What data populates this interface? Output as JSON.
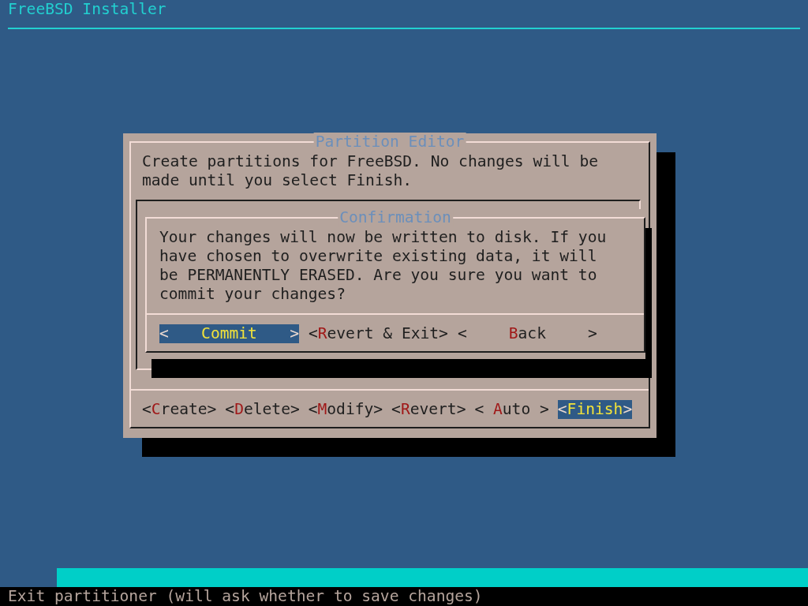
{
  "header": {
    "title": "FreeBSD Installer"
  },
  "dialog": {
    "title": "Partition Editor",
    "message": "Create partitions for FreeBSD. No changes will be made until you select Finish.",
    "buttons": [
      {
        "left": "<",
        "label": "Create",
        "right": ">",
        "selected": false
      },
      {
        "left": "<",
        "label": "Delete",
        "right": ">",
        "selected": false
      },
      {
        "left": "<",
        "label": "Modify",
        "right": ">",
        "selected": false
      },
      {
        "left": "<",
        "label": "Revert",
        "right": ">",
        "selected": false
      },
      {
        "left": "<",
        "label": "Auto",
        "right": ">",
        "selected": false
      },
      {
        "left": "<",
        "label": "Finish",
        "right": ">",
        "selected": true
      }
    ]
  },
  "confirmation": {
    "title": "Confirmation",
    "message": "Your changes will now be written to disk. If you have chosen to overwrite existing data, it will be PERMANENTLY ERASED. Are you sure you want to commit your changes?",
    "buttons": [
      {
        "left": "<",
        "label": "Commit",
        "right": ">",
        "selected": true
      },
      {
        "left": "<",
        "label": "Revert & Exit",
        "right": ">",
        "selected": false
      },
      {
        "left": "<",
        "label": "Back",
        "right": ">",
        "selected": false
      }
    ]
  },
  "status_bar": {
    "text": "Exit partitioner (will ask whether to save changes)"
  }
}
